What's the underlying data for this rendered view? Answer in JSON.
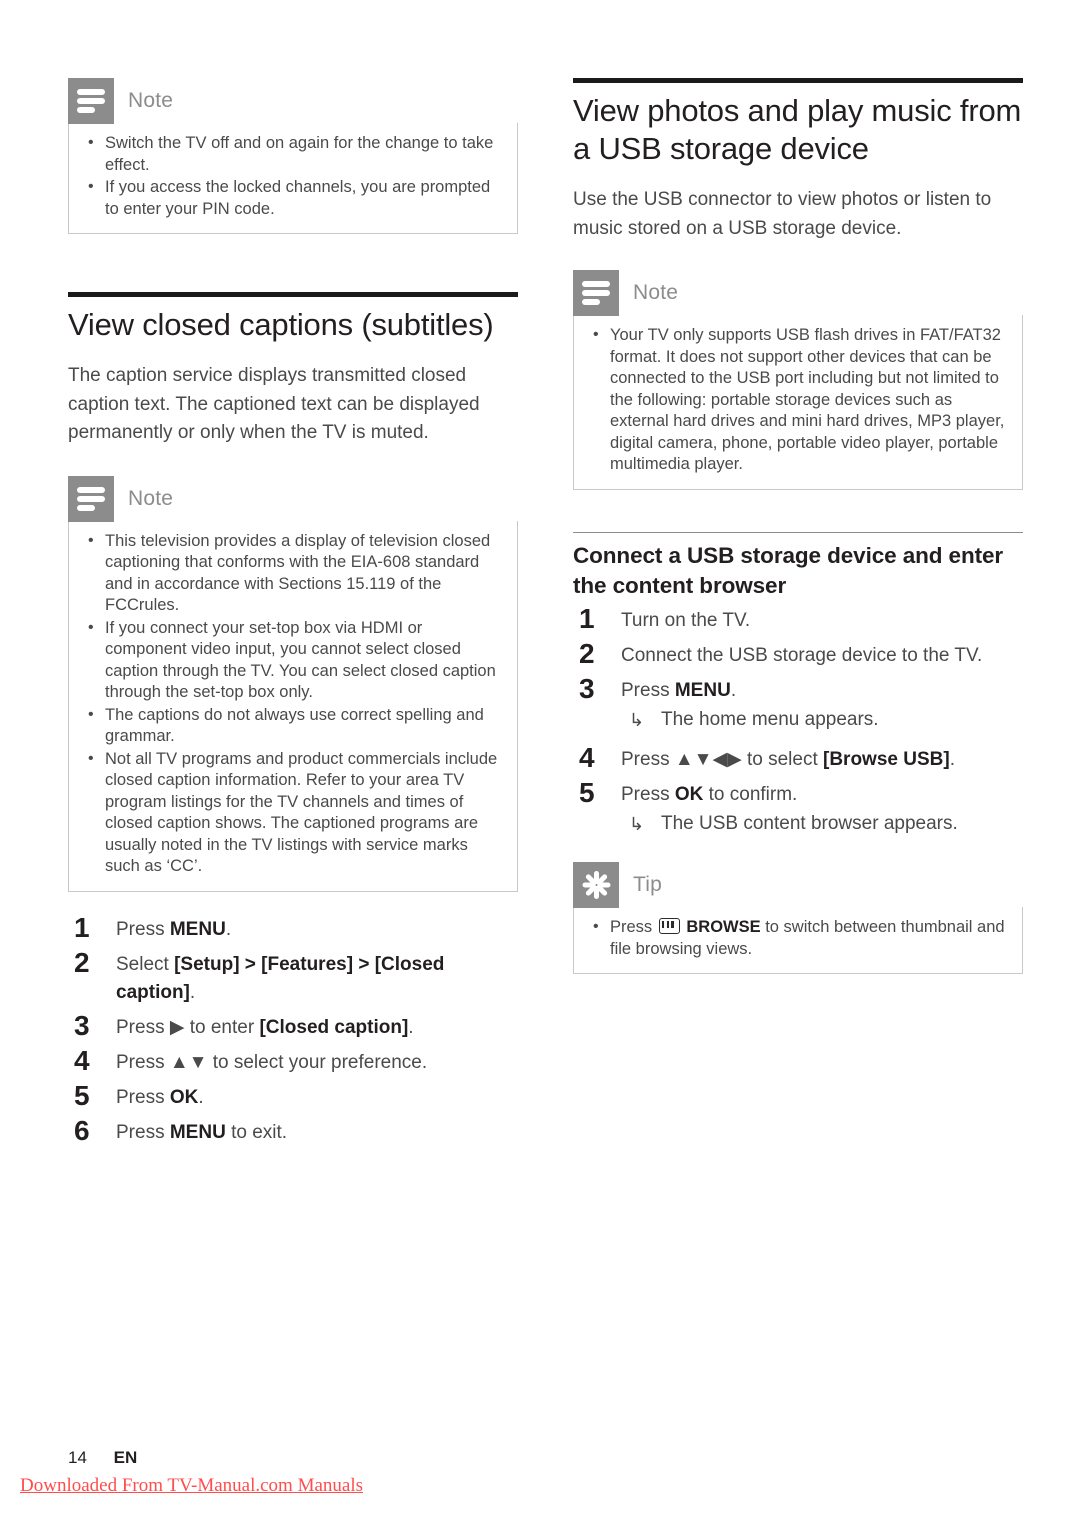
{
  "document": {
    "page_number": "14",
    "language_code": "EN",
    "watermark": "Downloaded From TV-Manual.com Manuals"
  },
  "icons": {
    "note": "note-lines-icon",
    "tip": "tip-asterisk-icon",
    "browse_key": "browse-key-icon"
  },
  "left_column": {
    "note_top": {
      "title": "Note",
      "bullets": [
        "Switch the TV off and on again for the change to take effect.",
        "If you access the locked channels, you are prompted to enter your PIN code."
      ]
    },
    "section": {
      "heading": "View closed captions (subtitles)",
      "intro": "The caption service displays transmitted closed caption text. The captioned text can be displayed permanently or only when the TV is muted."
    },
    "note_main": {
      "title": "Note",
      "bullets": [
        "This television provides a display of television closed captioning that conforms with the EIA-608 standard and in accordance with Sections 15.119 of the FCCrules.",
        "If you connect your set-top box via HDMI or component video input, you cannot select closed caption through the TV. You can select closed caption through the set-top box only.",
        "The captions do not always use correct spelling and grammar.",
        "Not all TV programs and product commercials include closed caption information. Refer to your area TV program listings for the TV channels and times of closed caption shows. The captioned programs are usually noted in the TV listings with service marks such as ‘CC’."
      ]
    },
    "steps": [
      {
        "text_before": "Press ",
        "bold": "MENU",
        "text_after": "."
      },
      {
        "text_before": "Select ",
        "bold": "[Setup] > [Features] > [Closed caption]",
        "text_after": "."
      },
      {
        "text_before": "Press ▶ to enter ",
        "bold": "[Closed caption]",
        "text_after": "."
      },
      {
        "text_before": "Press ▲▼ to select your preference.",
        "bold": "",
        "text_after": ""
      },
      {
        "text_before": "Press ",
        "bold": "OK",
        "text_after": "."
      },
      {
        "text_before": "Press ",
        "bold": "MENU",
        "text_after": " to exit."
      }
    ]
  },
  "right_column": {
    "section": {
      "heading": "View photos and play music from a USB storage device",
      "intro": "Use the USB connector to view photos or listen to music stored on a USB storage device."
    },
    "note_usb": {
      "title": "Note",
      "bullets": [
        "Your TV only supports USB flash drives in FAT/FAT32 format. It does not support other devices that can be connected to the USB port including but not limited to the following: portable storage devices such as external hard drives and mini hard drives, MP3 player, digital camera, phone, portable video player, portable multimedia player."
      ]
    },
    "subsection": {
      "heading": "Connect a USB storage device and enter the content browser",
      "steps": [
        {
          "text_before": "Turn on the TV.",
          "bold": "",
          "text_after": "",
          "result": ""
        },
        {
          "text_before": "Connect the USB storage device to the TV.",
          "bold": "",
          "text_after": "",
          "result": ""
        },
        {
          "text_before": "Press ",
          "bold": "MENU",
          "text_after": ".",
          "result": "The home menu appears."
        },
        {
          "text_before": "Press ▲▼◀▶ to select ",
          "bold": "[Browse USB]",
          "text_after": ".",
          "result": ""
        },
        {
          "text_before": "Press ",
          "bold": "OK",
          "text_after": " to confirm.",
          "result": "The USB content browser appears."
        }
      ]
    },
    "tip": {
      "title": "Tip",
      "bullet_before": "Press ",
      "bullet_bold": "BROWSE",
      "bullet_after": " to switch between thumbnail and file browsing views."
    }
  }
}
